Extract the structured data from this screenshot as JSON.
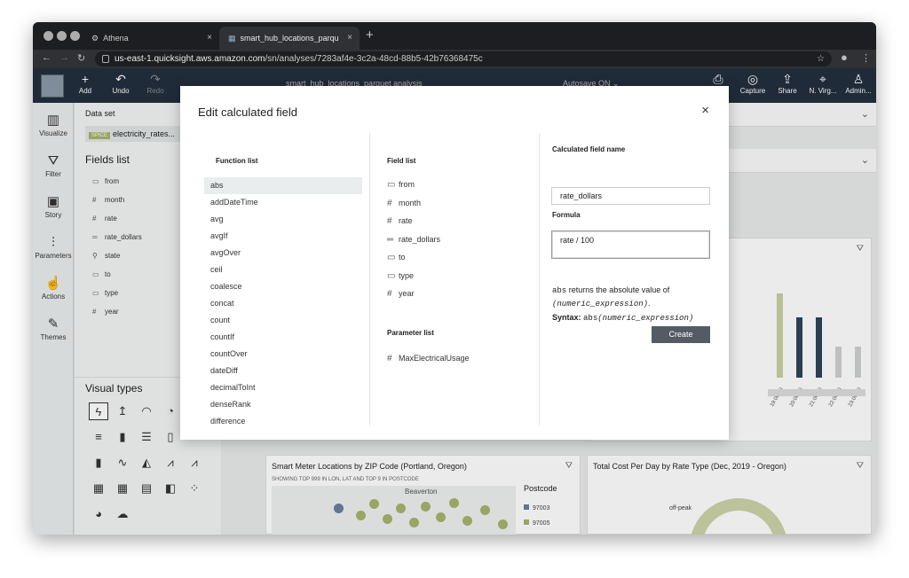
{
  "browser": {
    "tabs": [
      {
        "title": "Athena",
        "close": "×"
      },
      {
        "title": "smart_hub_locations_parquet a",
        "close": "×"
      }
    ],
    "new_tab": "+",
    "url_host": "us-east-1.quicksight.aws.amazon.com",
    "url_path": "/sn/analyses/7283af4e-3c2a-48cd-88b5-42b76368475c"
  },
  "toolbar": {
    "add": "Add",
    "undo": "Undo",
    "redo": "Redo",
    "analysis_name": "smart_hub_locations_parquet analysis",
    "autosave": "Autosave ON",
    "capture": "Capture",
    "share": "Share",
    "region": "N. Virg...",
    "admin": "Admin..."
  },
  "rail": [
    {
      "label": "Visualize",
      "icon": "visualize-icon"
    },
    {
      "label": "Filter",
      "icon": "filter-icon"
    },
    {
      "label": "Story",
      "icon": "story-icon"
    },
    {
      "label": "Parameters",
      "icon": "parameters-icon"
    },
    {
      "label": "Actions",
      "icon": "actions-icon"
    },
    {
      "label": "Themes",
      "icon": "themes-icon"
    }
  ],
  "sidebar": {
    "dataset_label": "Data set",
    "dataset_badge": "SPICE",
    "dataset_name": "electricity_rates...",
    "fields_title": "Fields list",
    "fields": [
      {
        "name": "from",
        "type": "string"
      },
      {
        "name": "month",
        "type": "number"
      },
      {
        "name": "rate",
        "type": "number"
      },
      {
        "name": "rate_dollars",
        "type": "calculated"
      },
      {
        "name": "state",
        "type": "geo"
      },
      {
        "name": "to",
        "type": "string"
      },
      {
        "name": "type",
        "type": "string"
      },
      {
        "name": "year",
        "type": "number"
      }
    ],
    "visual_types_title": "Visual types"
  },
  "cards": {
    "map": {
      "title": "Smart Meter Locations by ZIP Code (Portland, Oregon)",
      "subtitle": "SHOWING TOP 999 IN LON, LAT AND TOP 9 IN POSTCODE",
      "place": "Beaverton",
      "legend_title": "Postcode",
      "legend_items": [
        "97003",
        "97005"
      ]
    },
    "cost": {
      "title": "Total Cost Per Day by Rate Type (Dec, 2019 - Oregon)",
      "label": "off-peak"
    },
    "bar": {
      "x_labels": [
        "19:00:00",
        "20:00:00",
        "21:00:00",
        "22:00:00",
        "23:00:00"
      ]
    }
  },
  "modal": {
    "title": "Edit calculated field",
    "close": "×",
    "function_list_title": "Function list",
    "functions": [
      "abs",
      "addDateTime",
      "avg",
      "avgIf",
      "avgOver",
      "ceil",
      "coalesce",
      "concat",
      "count",
      "countIf",
      "countOver",
      "dateDiff",
      "decimalToInt",
      "denseRank",
      "difference"
    ],
    "selected_function": "abs",
    "field_list_title": "Field list",
    "fields": [
      {
        "name": "from",
        "type": "string"
      },
      {
        "name": "month",
        "type": "number"
      },
      {
        "name": "rate",
        "type": "number"
      },
      {
        "name": "rate_dollars",
        "type": "calculated"
      },
      {
        "name": "to",
        "type": "string"
      },
      {
        "name": "type",
        "type": "string"
      },
      {
        "name": "year",
        "type": "number"
      }
    ],
    "parameter_list_title": "Parameter list",
    "parameters": [
      {
        "name": "MaxElectricalUsage",
        "type": "number"
      }
    ],
    "name_label": "Calculated field name",
    "name_value": "rate_dollars",
    "formula_label": "Formula",
    "formula_value": "rate / 100",
    "desc_fn": "abs",
    "desc_mid": "returns the absolute value of",
    "desc_arg": "(numeric_expression)",
    "desc_end": ".",
    "syntax_label": "Syntax:",
    "syntax_fn": "abs",
    "syntax_arg": "(numeric_expression)",
    "create_label": "Create"
  },
  "colors": {
    "accent_olive": "#a6b36c",
    "bar_navy": "#2e4457",
    "app_bar": "#232f3e",
    "button": "#545b64"
  }
}
